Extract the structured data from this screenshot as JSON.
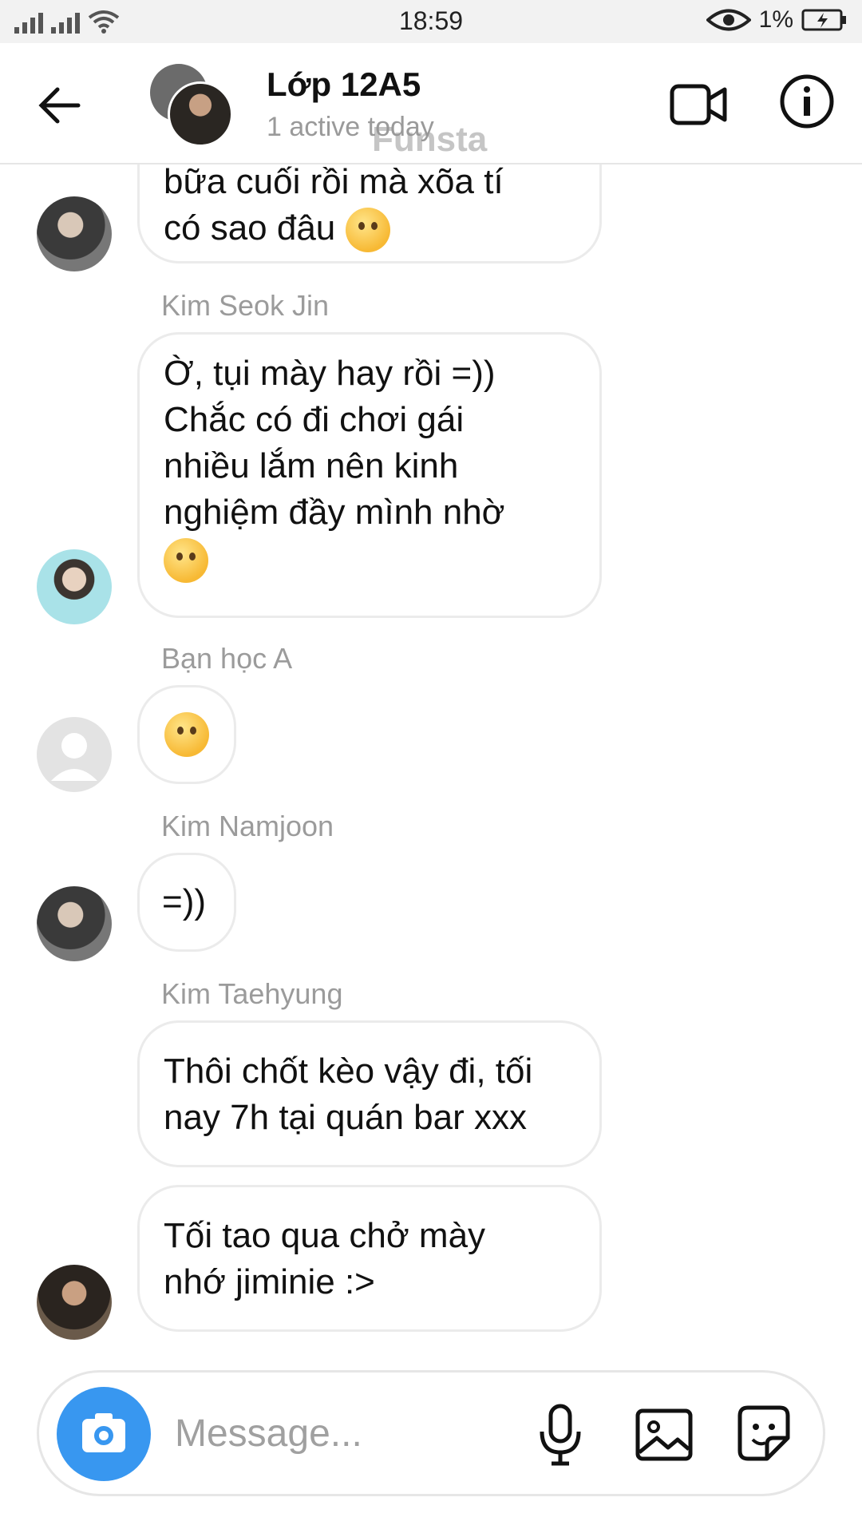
{
  "status_bar": {
    "time": "18:59",
    "battery": "1%"
  },
  "header": {
    "title": "Lớp 12A5",
    "subtitle": "1 active today",
    "watermark": "Funsta"
  },
  "messages": [
    {
      "sender": "",
      "lines": [
        "bữa cuối rồi mà xõa tí",
        "có sao đâu"
      ],
      "emoji": "wink-emoji"
    },
    {
      "sender": "Kim Seok Jin",
      "lines": [
        "Ờ, tụi mày hay rồi =))",
        "Chắc có đi chơi gái",
        "nhiều lắm nên kinh",
        "nghiệm đầy mình nhờ"
      ],
      "emoji": "relieved-emoji"
    },
    {
      "sender": "Bạn học A",
      "lines": [],
      "emoji": "tears-of-joy-emoji"
    },
    {
      "sender": "Kim Namjoon",
      "lines": [
        "=))"
      ]
    },
    {
      "sender": "Kim Taehyung",
      "lines": [
        "Thôi chốt kèo vậy đi, tối",
        "nay 7h tại quán bar xxx"
      ]
    },
    {
      "sender": "",
      "lines": [
        "Tối tao qua chở mày",
        "nhớ jiminie :>"
      ]
    }
  ],
  "composer": {
    "placeholder": "Message..."
  },
  "colors": {
    "accent": "#3897f0",
    "bubble_border": "#ebebeb",
    "secondary_text": "#9b9b9b"
  }
}
